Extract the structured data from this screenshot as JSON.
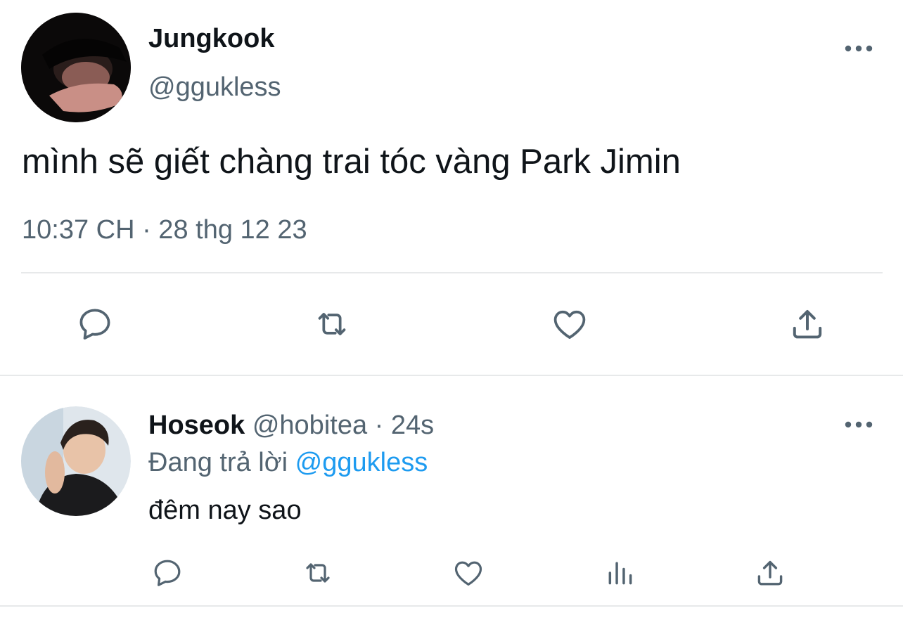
{
  "main_tweet": {
    "author_name": "Jungkook",
    "author_handle": "@ggukless",
    "text": "mình sẽ giết chàng trai tóc vàng Park Jimin",
    "timestamp": "10:37 CH · 28 thg 12 23",
    "actions": [
      "reply-icon",
      "retweet-icon",
      "like-icon",
      "share-icon"
    ]
  },
  "reply_tweet": {
    "author_name": "Hoseok",
    "author_handle": "@hobitea",
    "separator": "·",
    "time_ago": "24s",
    "replying_prefix": "Đang trả lời",
    "replying_to": "@ggukless",
    "text": "đêm nay sao",
    "actions": [
      "reply-icon",
      "retweet-icon",
      "like-icon",
      "analytics-icon",
      "share-icon"
    ]
  },
  "colors": {
    "text_primary": "#0f1419",
    "text_secondary": "#536471",
    "link": "#1d9bf0",
    "divider": "#e7e9ea"
  }
}
